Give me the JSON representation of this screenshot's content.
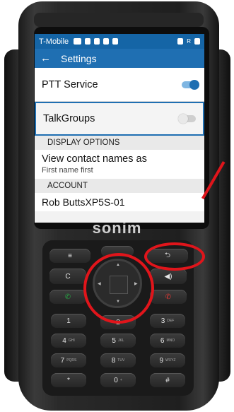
{
  "status_bar": {
    "carrier": "T-Mobile",
    "right_icons": "R"
  },
  "app_bar": {
    "back_icon": "←",
    "title": "Settings"
  },
  "settings": {
    "ptt_service": {
      "label": "PTT Service",
      "enabled": true
    },
    "talkgroups": {
      "label": "TalkGroups",
      "enabled": false
    },
    "display_options_header": "DISPLAY OPTIONS",
    "view_contact_names": {
      "title": "View contact names as",
      "value": "First name first"
    },
    "account_header": "ACCOUNT",
    "account_name": "Rob ButtsXP5S-01"
  },
  "device": {
    "brand": "sonim",
    "keys": {
      "menu": "≡",
      "c": "C",
      "volume": "◀)",
      "k1": "1",
      "k2": "2",
      "k3": "3",
      "k4": "4",
      "k5": "5",
      "k6": "6",
      "k7": "7",
      "k8": "8",
      "k9": "9",
      "star": "*",
      "k0": "0",
      "hash": "#",
      "k3_sub": "DEF",
      "k4_sub": "GHI",
      "k5_sub": "JKL",
      "k6_sub": "MNO",
      "k7_sub": "PQRS",
      "k8_sub": "TUV",
      "k9_sub": "WXYZ",
      "k0_sub": "+"
    }
  },
  "colors": {
    "status_bar": "#1565a6",
    "app_bar": "#1f6fb2",
    "annotation": "#e0151b"
  }
}
